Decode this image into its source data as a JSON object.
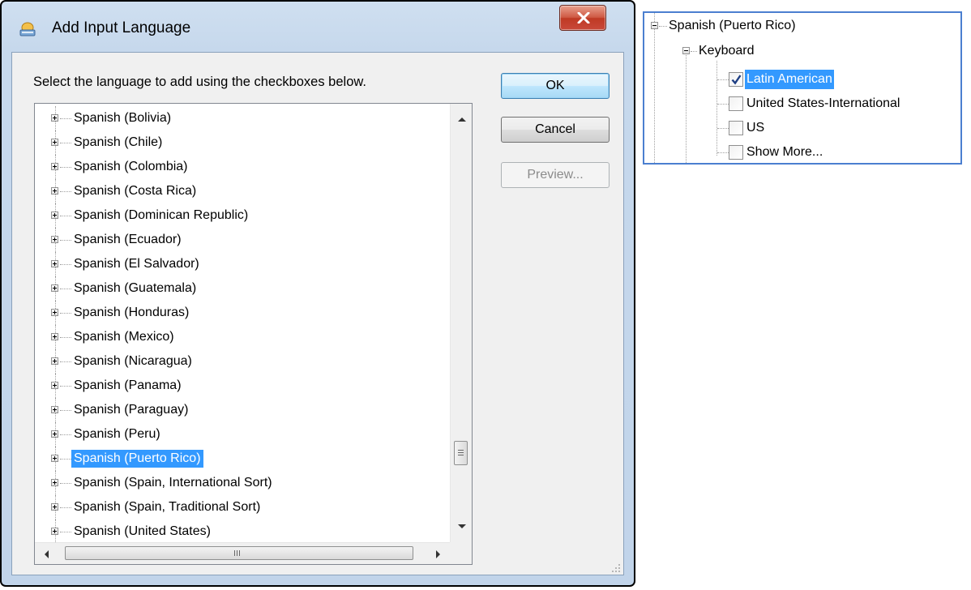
{
  "dialog": {
    "title": "Add Input Language",
    "instruction": "Select the language to add using the checkboxes below.",
    "buttons": {
      "ok": "OK",
      "cancel": "Cancel",
      "preview": "Preview..."
    },
    "languages": [
      "Spanish (Bolivia)",
      "Spanish (Chile)",
      "Spanish (Colombia)",
      "Spanish (Costa Rica)",
      "Spanish (Dominican Republic)",
      "Spanish (Ecuador)",
      "Spanish (El Salvador)",
      "Spanish (Guatemala)",
      "Spanish (Honduras)",
      "Spanish (Mexico)",
      "Spanish (Nicaragua)",
      "Spanish (Panama)",
      "Spanish (Paraguay)",
      "Spanish (Peru)",
      "Spanish (Puerto Rico)",
      "Spanish (Spain, International Sort)",
      "Spanish (Spain, Traditional Sort)",
      "Spanish (United States)"
    ],
    "selected_language": "Spanish (Puerto Rico)"
  },
  "inset": {
    "language": "Spanish (Puerto Rico)",
    "category": "Keyboard",
    "keyboards": [
      {
        "label": "Latin American",
        "checked": true,
        "selected": true
      },
      {
        "label": "United States-International",
        "checked": false,
        "selected": false
      },
      {
        "label": "US",
        "checked": false,
        "selected": false
      },
      {
        "label": "Show More...",
        "checked": false,
        "selected": false
      }
    ]
  },
  "colors": {
    "selection": "#3399ff",
    "inset_border": "#4b7fd0",
    "close_button": "#c9493a"
  },
  "icons": {
    "app": "keyboard-globe-icon",
    "close": "close-icon",
    "expand": "plus-expander-icon",
    "collapse": "minus-expander-icon",
    "check": "checkmark-icon"
  }
}
